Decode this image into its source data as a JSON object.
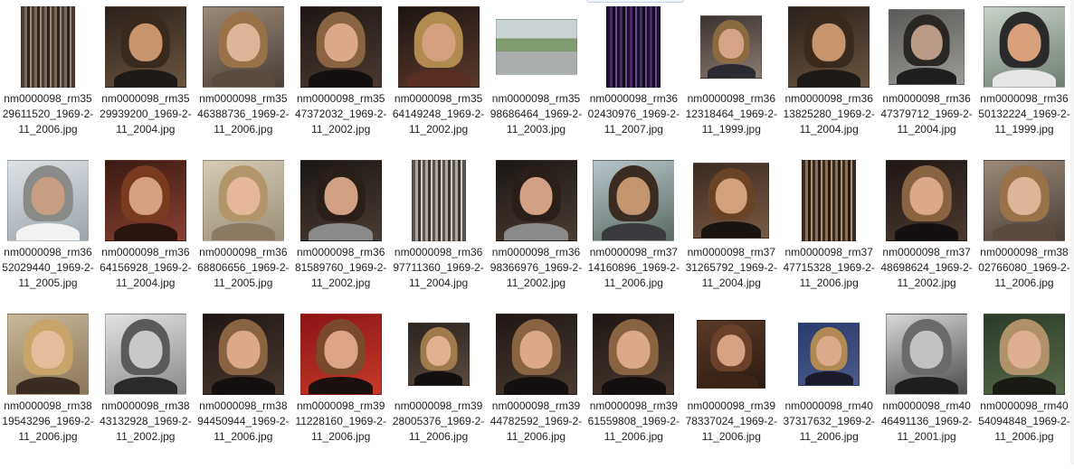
{
  "view": {
    "type": "thumbnail-grid",
    "item_count": 33
  },
  "files": [
    {
      "name": "nm0000098_rm3529611520_1969-2-11_2006.jpg",
      "thumb": "streaks-dark"
    },
    {
      "name": "nm0000098_rm3529939200_1969-2-11_2004.jpg",
      "thumb": "man-dark"
    },
    {
      "name": "nm0000098_rm3546388736_1969-2-11_2006.jpg",
      "thumb": "woman-warm"
    },
    {
      "name": "nm0000098_rm3547372032_1969-2-11_2002.jpg",
      "thumb": "woman-dark"
    },
    {
      "name": "nm0000098_rm3564149248_1969-2-11_2002.jpg",
      "thumb": "man-blond"
    },
    {
      "name": "nm0000098_rm3598686464_1969-2-11_2003.jpg",
      "thumb": "street"
    },
    {
      "name": "nm0000098_rm3602430976_1969-2-11_2007.jpg",
      "thumb": "streaks-purple"
    },
    {
      "name": "nm0000098_rm3612318464_1969-2-11_1999.jpg",
      "thumb": "man-young"
    },
    {
      "name": "nm0000098_rm3613825280_1969-2-11_2004.jpg",
      "thumb": "man-dark"
    },
    {
      "name": "nm0000098_rm3647379712_1969-2-11_2004.jpg",
      "thumb": "man-gray"
    },
    {
      "name": "nm0000098_rm3650132224_1969-2-11_1999.jpg",
      "thumb": "cartoon"
    },
    {
      "name": "nm0000098_rm3652029440_1969-2-11_2005.jpg",
      "thumb": "man-profile"
    },
    {
      "name": "nm0000098_rm3664156928_1969-2-11_2004.jpg",
      "thumb": "woman-red"
    },
    {
      "name": "nm0000098_rm3668806656_1969-2-11_2005.jpg",
      "thumb": "woman-light"
    },
    {
      "name": "nm0000098_rm3681589760_1969-2-11_2002.jpg",
      "thumb": "man-scarf"
    },
    {
      "name": "nm0000098_rm3697711360_1969-2-11_2004.jpg",
      "thumb": "streaks-gray"
    },
    {
      "name": "nm0000098_rm3698366976_1969-2-11_2002.jpg",
      "thumb": "man-scarf"
    },
    {
      "name": "nm0000098_rm3714160896_1969-2-11_2006.jpg",
      "thumb": "man-outdoor"
    },
    {
      "name": "nm0000098_rm3731265792_1969-2-11_2004.jpg",
      "thumb": "woman-side"
    },
    {
      "name": "nm0000098_rm3747715328_1969-2-11_2006.jpg",
      "thumb": "streaks-brown"
    },
    {
      "name": "nm0000098_rm3748698624_1969-2-11_2002.jpg",
      "thumb": "woman-dark"
    },
    {
      "name": "nm0000098_rm3802766080_1969-2-11_2006.jpg",
      "thumb": "woman-warm"
    },
    {
      "name": "nm0000098_rm3819543296_1969-2-11_2006.jpg",
      "thumb": "woman-blonde"
    },
    {
      "name": "nm0000098_rm3843132928_1969-2-11_2002.jpg",
      "thumb": "woman-bw"
    },
    {
      "name": "nm0000098_rm3894450944_1969-2-11_2006.jpg",
      "thumb": "woman-dark"
    },
    {
      "name": "nm0000098_rm3911228160_1969-2-11_2006.jpg",
      "thumb": "woman-redbg"
    },
    {
      "name": "nm0000098_rm3928005376_1969-2-11_2006.jpg",
      "thumb": "woman-small"
    },
    {
      "name": "nm0000098_rm3944782592_1969-2-11_2006.jpg",
      "thumb": "woman-dark"
    },
    {
      "name": "nm0000098_rm3961559808_1969-2-11_2006.jpg",
      "thumb": "woman-dark"
    },
    {
      "name": "nm0000098_rm3978337024_1969-2-11_2006.jpg",
      "thumb": "woman-brown"
    },
    {
      "name": "nm0000098_rm4037317632_1969-2-11_2006.jpg",
      "thumb": "woman-blue"
    },
    {
      "name": "nm0000098_rm4046491136_1969-2-11_2001.jpg",
      "thumb": "woman-bw2"
    },
    {
      "name": "nm0000098_rm4054094848_1969-2-11_2006.jpg",
      "thumb": "woman-olive"
    }
  ]
}
